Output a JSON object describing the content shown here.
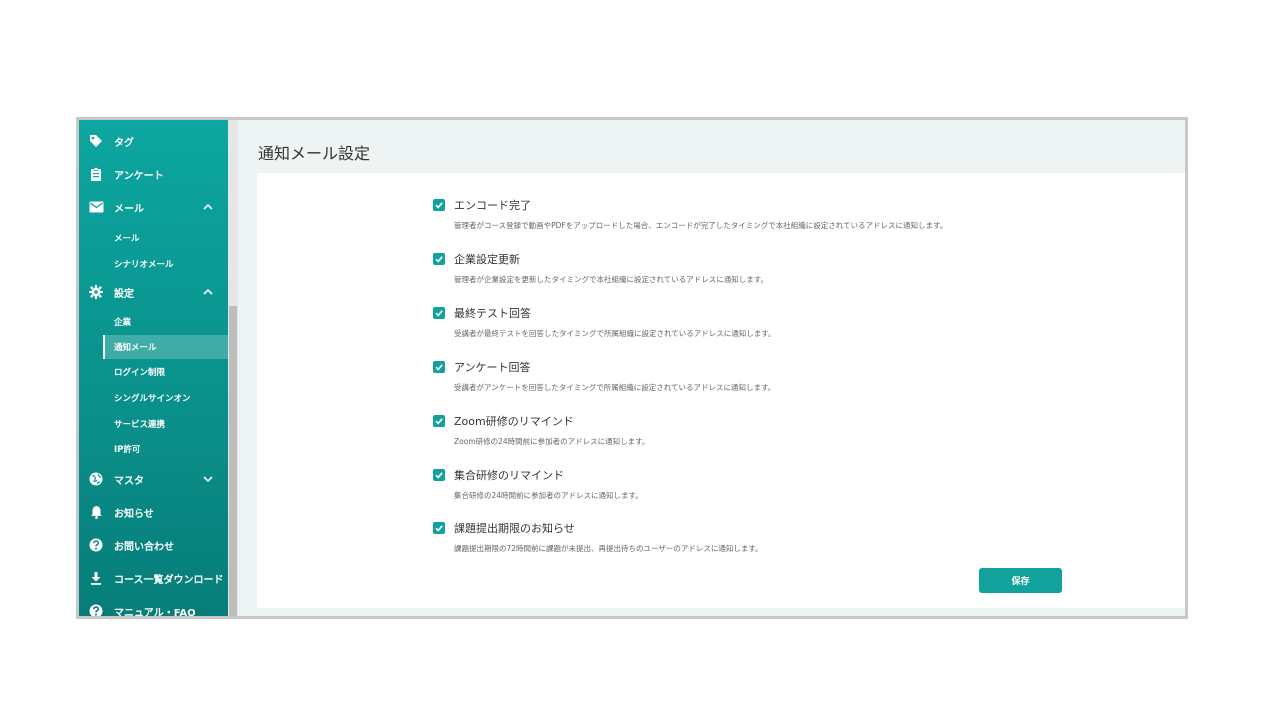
{
  "sidebar": {
    "items": [
      {
        "label": "タグ",
        "icon": "tag-icon"
      },
      {
        "label": "アンケート",
        "icon": "clipboard-icon"
      },
      {
        "label": "メール",
        "icon": "mail-icon",
        "expanded": true
      },
      {
        "label": "設定",
        "icon": "gear-icon",
        "expanded": true
      },
      {
        "label": "マスタ",
        "icon": "globe-icon",
        "expanded": false
      },
      {
        "label": "お知らせ",
        "icon": "bell-icon"
      },
      {
        "label": "お問い合わせ",
        "icon": "help-icon"
      },
      {
        "label": "コース一覧ダウンロード",
        "icon": "download-icon"
      },
      {
        "label": "マニュアル・FAQ",
        "icon": "help-icon"
      }
    ],
    "mail_sub": [
      "メール",
      "シナリオメール"
    ],
    "settings_sub": [
      "企業",
      "通知メール",
      "ログイン制限",
      "シングルサインオン",
      "サービス連携",
      "IP許可"
    ],
    "active_sub": "通知メール"
  },
  "page": {
    "title": "通知メール設定"
  },
  "settings": [
    {
      "title": "エンコード完了",
      "desc": "管理者がコース登録で動画やPDFをアップロードした場合、エンコードが完了したタイミングで本社組織に設定されているアドレスに通知します。",
      "checked": true
    },
    {
      "title": "企業設定更新",
      "desc": "管理者が企業設定を更新したタイミングで本社組織に設定されているアドレスに通知します。",
      "checked": true
    },
    {
      "title": "最終テスト回答",
      "desc": "受講者が最終テストを回答したタイミングで所属組織に設定されているアドレスに通知します。",
      "checked": true
    },
    {
      "title": "アンケート回答",
      "desc": "受講者がアンケートを回答したタイミングで所属組織に設定されているアドレスに通知します。",
      "checked": true
    },
    {
      "title": "Zoom研修のリマインド",
      "desc": "Zoom研修の24時間前に参加者のアドレスに通知します。",
      "checked": true
    },
    {
      "title": "集合研修のリマインド",
      "desc": "集合研修の24時間前に参加者のアドレスに通知します。",
      "checked": true
    },
    {
      "title": "課題提出期限のお知らせ",
      "desc": "課題提出期限の72時間前に課題が未提出、再提出待ちのユーザーのアドレスに通知します。",
      "checked": true
    }
  ],
  "save_label": "保存",
  "colors": {
    "accent": "#12a29c",
    "sidebar_top": "#0da6a0",
    "sidebar_bottom": "#077d79"
  }
}
